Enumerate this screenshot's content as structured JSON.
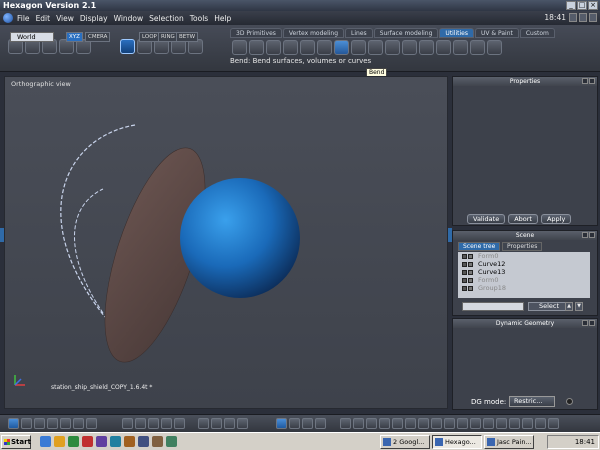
{
  "app": {
    "title": "Hexagon Version 2.1",
    "clock": "18:41"
  },
  "menu": {
    "items": [
      "File",
      "Edit",
      "View",
      "Display",
      "Window",
      "Selection",
      "Tools",
      "Help"
    ]
  },
  "toolbar": {
    "tabs": [
      {
        "label": "3D Primitives",
        "active": false
      },
      {
        "label": "Vertex modeling",
        "active": false
      },
      {
        "label": "Lines",
        "active": false
      },
      {
        "label": "Surface modeling",
        "active": false
      },
      {
        "label": "Utilities",
        "active": true
      },
      {
        "label": "UV & Paint",
        "active": false
      },
      {
        "label": "Custom",
        "active": false
      }
    ],
    "coord_space": "World",
    "chips": [
      "XYZ",
      "CMERA",
      "LOOP",
      "RING",
      "BETW"
    ],
    "status": "Bend: Bend surfaces, volumes or curves",
    "tooltip": "Bend"
  },
  "viewport": {
    "label": "Orthographic view",
    "file_name": "station_ship_shield_COPY_1.6.4t *"
  },
  "properties_panel": {
    "title": "Properties",
    "buttons": {
      "validate": "Validate",
      "abort": "Abort",
      "apply": "Apply"
    }
  },
  "scene_panel": {
    "title": "Scene",
    "tabs": {
      "tree": "Scene tree",
      "properties": "Properties"
    },
    "items": [
      {
        "name": "Curve12",
        "dim": false
      },
      {
        "name": "Curve13",
        "dim": false
      },
      {
        "name": "Form0",
        "dim": true
      },
      {
        "name": "Group18",
        "dim": true
      },
      {
        "name": "Form0",
        "dim": false
      }
    ],
    "select_label": "Select"
  },
  "dg_panel": {
    "title": "Dynamic Geometry",
    "mode_label": "DG mode:",
    "mode_value": "Restric..."
  },
  "taskbar": {
    "start": "Start",
    "tasks": [
      {
        "label": "2 Googl...",
        "active": false
      },
      {
        "label": "Hexago...",
        "active": true
      },
      {
        "label": "Jasc Pain...",
        "active": false
      }
    ],
    "clock": "18:41"
  },
  "colors": {
    "accent": "#2f6aa8",
    "sphere": "#1c6fc0",
    "disc": "#5a4745",
    "background": "#454953"
  }
}
